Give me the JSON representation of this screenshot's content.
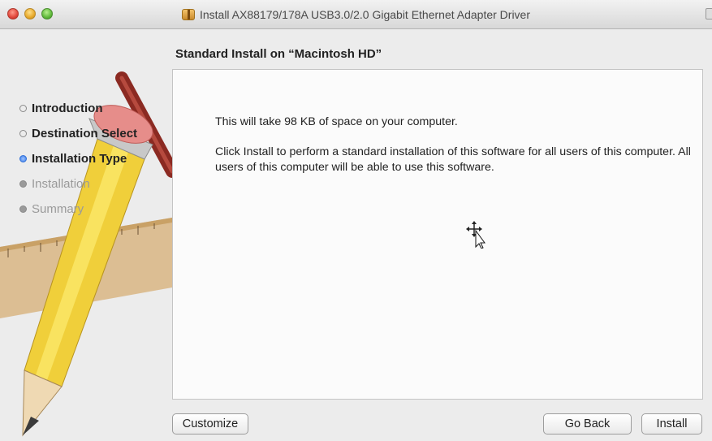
{
  "window": {
    "title": "Install AX88179/178A USB3.0/2.0 Gigabit Ethernet Adapter Driver"
  },
  "sidebar": {
    "steps": [
      {
        "label": "Introduction",
        "state": "done"
      },
      {
        "label": "Destination Select",
        "state": "done"
      },
      {
        "label": "Installation Type",
        "state": "current"
      },
      {
        "label": "Installation",
        "state": "future"
      },
      {
        "label": "Summary",
        "state": "future"
      }
    ]
  },
  "main": {
    "heading": "Standard Install on “Macintosh HD”",
    "space_text": "This will take 98 KB of space on your computer.",
    "description": "Click Install to perform a standard installation of this software for all users of this computer. All users of this computer will be able to use this software."
  },
  "buttons": {
    "customize": "Customize",
    "go_back": "Go Back",
    "install": "Install"
  },
  "colors": {
    "current_step_bullet": "#3a7ae6",
    "window_background": "#ececec"
  }
}
